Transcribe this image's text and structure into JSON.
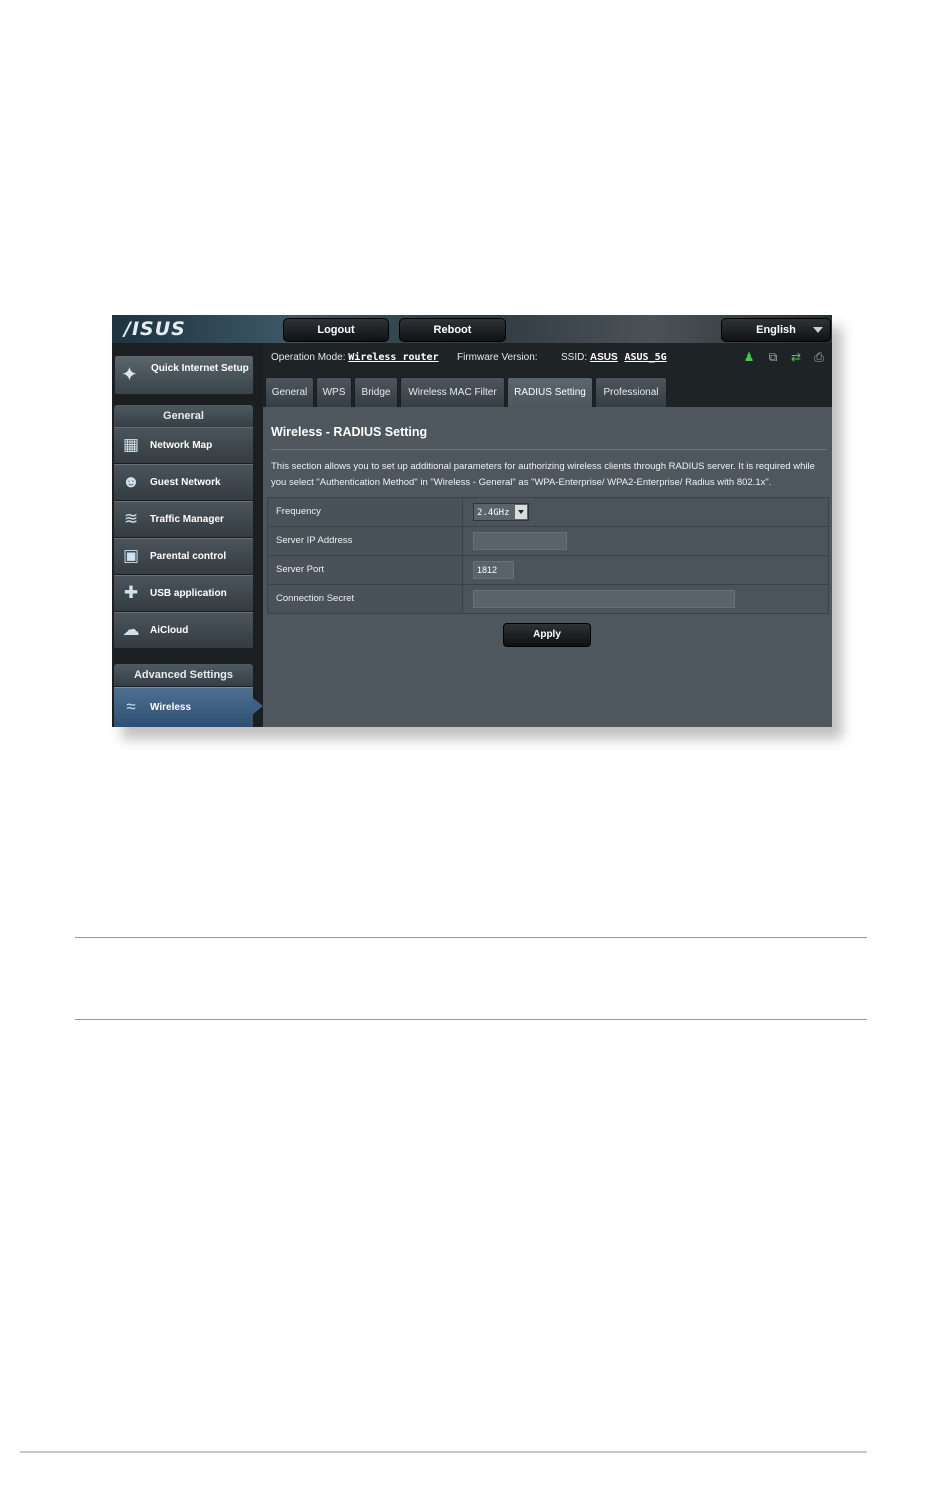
{
  "header": {
    "logo": "/ISUS",
    "logout_label": "Logout",
    "reboot_label": "Reboot",
    "language": "English"
  },
  "status": {
    "op_mode_label": "Operation Mode:",
    "op_mode_value": "Wireless router",
    "firmware_label": "Firmware Version:",
    "ssid_label": "SSID:",
    "ssid_1": "ASUS",
    "ssid_2": "ASUS_5G"
  },
  "sidebar": {
    "quick_setup": "Quick Internet Setup",
    "general_heading": "General",
    "items": [
      {
        "label": "Network Map"
      },
      {
        "label": "Guest Network"
      },
      {
        "label": "Traffic Manager"
      },
      {
        "label": "Parental control"
      },
      {
        "label": "USB application"
      },
      {
        "label": "AiCloud"
      }
    ],
    "advanced_heading": "Advanced Settings",
    "active_item": "Wireless"
  },
  "tabs": [
    "General",
    "WPS",
    "Bridge",
    "Wireless MAC Filter",
    "RADIUS Setting",
    "Professional"
  ],
  "main": {
    "title": "Wireless - RADIUS Setting",
    "description_line1": "This section allows you to set up additional parameters for authorizing wireless clients through RADIUS server. It is required while",
    "description_line2": "you select \"Authentication Method\" in \"Wireless - General\" as \"WPA-Enterprise/ WPA2-Enterprise/ Radius with 802.1x\".",
    "fields": {
      "frequency_label": "Frequency",
      "frequency_value": "2.4GHz",
      "server_ip_label": "Server IP Address",
      "server_ip_value": "",
      "server_port_label": "Server Port",
      "server_port_value": "1812",
      "secret_label": "Connection Secret",
      "secret_value": ""
    },
    "apply_label": "Apply"
  },
  "icons": [
    "wand-icon",
    "network-map-icon",
    "guest-network-icon",
    "traffic-manager-icon",
    "parental-lock-icon",
    "usb-puzzle-icon",
    "cloud-icon",
    "wifi-icon",
    "user-status-icon",
    "devices-status-icon",
    "usb-status-icon",
    "printer-status-icon"
  ],
  "colors": {
    "status_green": "#3fcf3f",
    "active_nav": "#3c5f83",
    "panel": "#4d575d"
  }
}
